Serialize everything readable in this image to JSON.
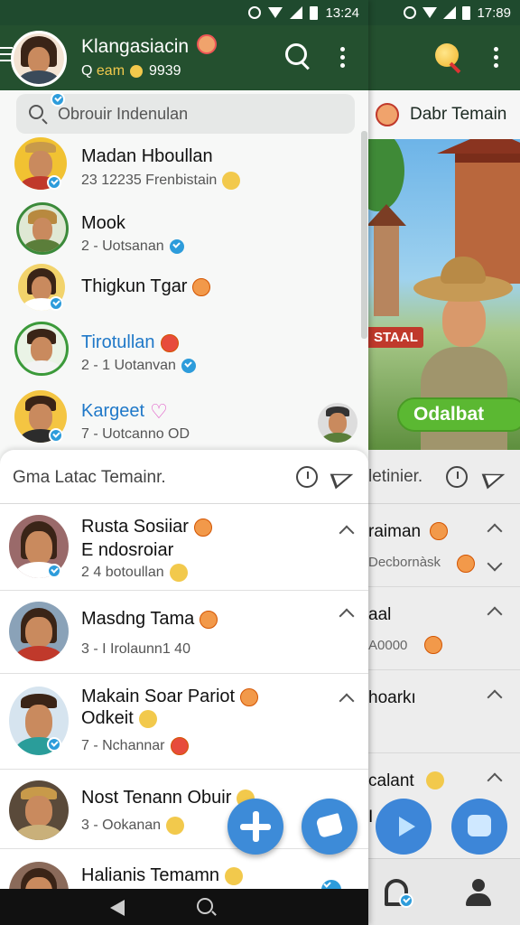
{
  "left": {
    "status_time": "13:24",
    "header": {
      "title": "Klangasiacin",
      "subtitle_prefix": "Q",
      "subtitle_highlight": "eam",
      "subtitle_suffix": "9939"
    },
    "search_placeholder": "Obrouir Indenulan",
    "contacts": [
      {
        "name": "Madan Hboullan",
        "sub": "23 12235 Frenbistain",
        "name_color": "#111111"
      },
      {
        "name": "Mook",
        "sub": "2 - Uotsanan",
        "name_color": "#111111"
      },
      {
        "name": "Thigkun Tgar",
        "sub": "",
        "name_color": "#111111"
      },
      {
        "name": "Tirotullan",
        "sub": "2 - 1 Uotanvan",
        "name_color": "#1f78c8"
      },
      {
        "name": "Kargeet",
        "sub": "7 - Uotcanno OD",
        "name_color": "#1f78c8"
      }
    ],
    "sheet": {
      "title": "Gma Latac Temainr.",
      "chats": [
        {
          "name": "Rusta Sosiiar",
          "line2": "E ndosroiar",
          "sub": "2 4 botoullan"
        },
        {
          "name": "Masdng Tama",
          "line2": "",
          "sub": "3 - I Irolaunn1 40"
        },
        {
          "name": "Makain Soar Pariot",
          "line2": "Odkeit",
          "sub": "7 - Nchannar"
        },
        {
          "name": "Nost Tenann Obuir",
          "line2": "",
          "sub": "3 - Ookanan"
        },
        {
          "name": "Halianis Temamn",
          "line2": "",
          "sub": ""
        }
      ]
    }
  },
  "right": {
    "status_time": "17:89",
    "title": "Dabr Temain",
    "banner_tag": "STAAL",
    "banner_button": "Odalbat",
    "sheet_title": "letinier.",
    "rows": [
      {
        "name": "raiman",
        "sub": "Decbornàsk"
      },
      {
        "name": "aal",
        "sub": "A0000"
      },
      {
        "name": "hoarkı",
        "sub": ""
      },
      {
        "name": "calant",
        "sub": ""
      }
    ],
    "row5_fragment": "I"
  },
  "colors": {
    "header_green": "#24502f",
    "accent_blue": "#3d8bd8",
    "verified_blue": "#2d9cdb",
    "cta_green": "#5bb832"
  }
}
